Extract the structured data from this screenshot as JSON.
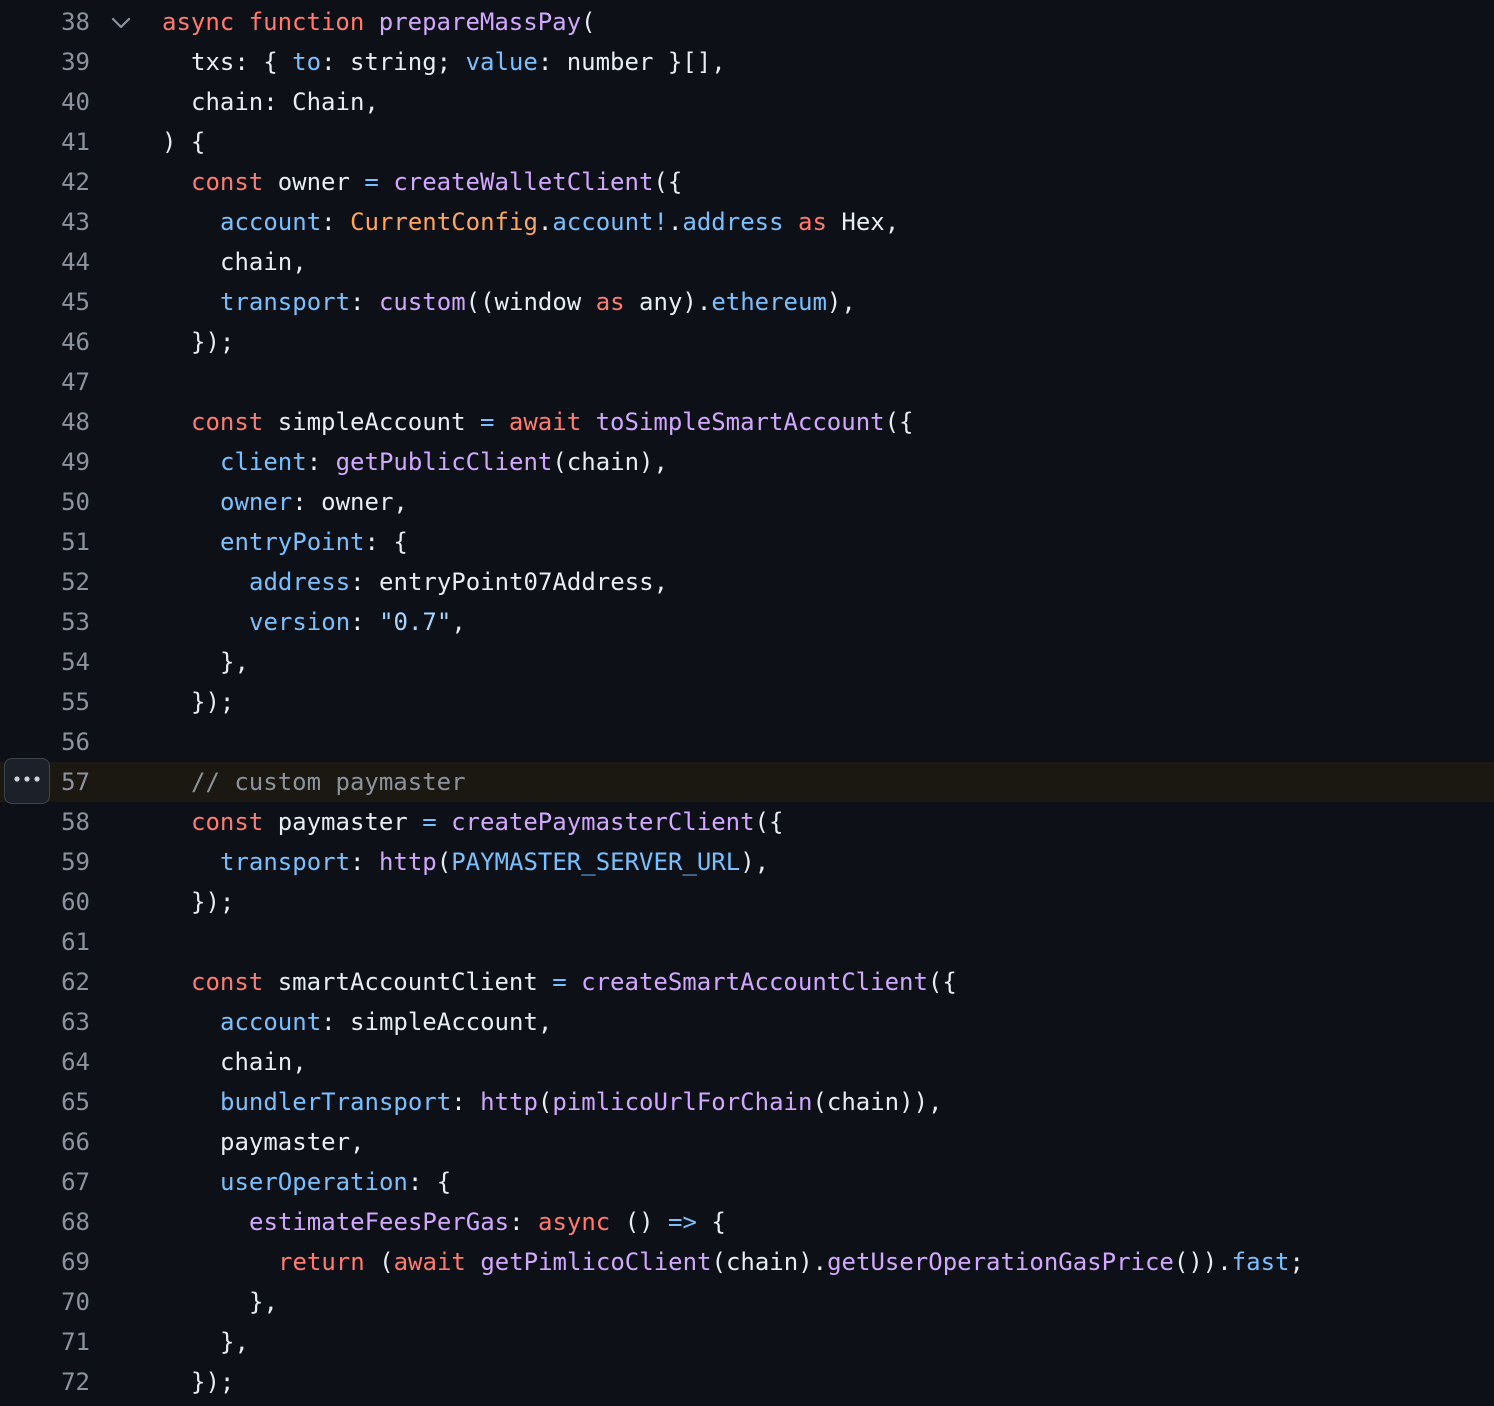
{
  "colors": {
    "background": "#0d1117",
    "line_number": "#8b949e",
    "highlight_background": "#1b1811",
    "text": "#e6edf3",
    "keyword": "#ff7b72",
    "function": "#d2a8ff",
    "property": "#79c0ff",
    "constant": "#ffa657",
    "string": "#a5d6ff",
    "comment": "#8b949e",
    "operator": "#79c0ff"
  },
  "fold_icon": "chevron-down-icon",
  "more_options_icon": "kebab-horizontal-icon",
  "highlighted_line": "57",
  "lines": [
    {
      "number": "38",
      "indent": 0,
      "foldable": true,
      "tokens": [
        {
          "t": "async",
          "c": "keyword"
        },
        {
          "t": " "
        },
        {
          "t": "function",
          "c": "keyword"
        },
        {
          "t": " "
        },
        {
          "t": "prepareMassPay",
          "c": "function"
        },
        {
          "t": "("
        }
      ]
    },
    {
      "number": "39",
      "indent": 1,
      "tokens": [
        {
          "t": "txs: { "
        },
        {
          "t": "to",
          "c": "property"
        },
        {
          "t": ": string; "
        },
        {
          "t": "value",
          "c": "property"
        },
        {
          "t": ": number }[],"
        }
      ]
    },
    {
      "number": "40",
      "indent": 1,
      "tokens": [
        {
          "t": "chain: Chain,"
        }
      ]
    },
    {
      "number": "41",
      "indent": 0,
      "tokens": [
        {
          "t": ") {"
        }
      ]
    },
    {
      "number": "42",
      "indent": 1,
      "tokens": [
        {
          "t": "const",
          "c": "keyword"
        },
        {
          "t": " owner "
        },
        {
          "t": "=",
          "c": "operator"
        },
        {
          "t": " "
        },
        {
          "t": "createWalletClient",
          "c": "function"
        },
        {
          "t": "({"
        }
      ]
    },
    {
      "number": "43",
      "indent": 2,
      "tokens": [
        {
          "t": "account",
          "c": "property"
        },
        {
          "t": ": "
        },
        {
          "t": "CurrentConfig",
          "c": "constant"
        },
        {
          "t": "."
        },
        {
          "t": "account!",
          "c": "property"
        },
        {
          "t": "."
        },
        {
          "t": "address",
          "c": "property"
        },
        {
          "t": " "
        },
        {
          "t": "as",
          "c": "keyword"
        },
        {
          "t": " Hex,"
        }
      ]
    },
    {
      "number": "44",
      "indent": 2,
      "tokens": [
        {
          "t": "chain,"
        }
      ]
    },
    {
      "number": "45",
      "indent": 2,
      "tokens": [
        {
          "t": "transport",
          "c": "property"
        },
        {
          "t": ": "
        },
        {
          "t": "custom",
          "c": "function"
        },
        {
          "t": "((window "
        },
        {
          "t": "as",
          "c": "keyword"
        },
        {
          "t": " any)."
        },
        {
          "t": "ethereum",
          "c": "property"
        },
        {
          "t": "),"
        }
      ]
    },
    {
      "number": "46",
      "indent": 1,
      "tokens": [
        {
          "t": "});"
        }
      ]
    },
    {
      "number": "47",
      "indent": 0,
      "tokens": []
    },
    {
      "number": "48",
      "indent": 1,
      "tokens": [
        {
          "t": "const",
          "c": "keyword"
        },
        {
          "t": " simpleAccount "
        },
        {
          "t": "=",
          "c": "operator"
        },
        {
          "t": " "
        },
        {
          "t": "await",
          "c": "keyword"
        },
        {
          "t": " "
        },
        {
          "t": "toSimpleSmartAccount",
          "c": "function"
        },
        {
          "t": "({"
        }
      ]
    },
    {
      "number": "49",
      "indent": 2,
      "tokens": [
        {
          "t": "client",
          "c": "property"
        },
        {
          "t": ": "
        },
        {
          "t": "getPublicClient",
          "c": "function"
        },
        {
          "t": "(chain),"
        }
      ]
    },
    {
      "number": "50",
      "indent": 2,
      "tokens": [
        {
          "t": "owner",
          "c": "property"
        },
        {
          "t": ": owner,"
        }
      ]
    },
    {
      "number": "51",
      "indent": 2,
      "tokens": [
        {
          "t": "entryPoint",
          "c": "property"
        },
        {
          "t": ": {"
        }
      ]
    },
    {
      "number": "52",
      "indent": 3,
      "tokens": [
        {
          "t": "address",
          "c": "property"
        },
        {
          "t": ": entryPoint07Address,"
        }
      ]
    },
    {
      "number": "53",
      "indent": 3,
      "tokens": [
        {
          "t": "version",
          "c": "property"
        },
        {
          "t": ": "
        },
        {
          "t": "\"0.7\"",
          "c": "string"
        },
        {
          "t": ","
        }
      ]
    },
    {
      "number": "54",
      "indent": 2,
      "tokens": [
        {
          "t": "},"
        }
      ]
    },
    {
      "number": "55",
      "indent": 1,
      "tokens": [
        {
          "t": "});"
        }
      ]
    },
    {
      "number": "56",
      "indent": 0,
      "tokens": []
    },
    {
      "number": "57",
      "indent": 1,
      "tokens": [
        {
          "t": "// custom paymaster",
          "c": "comment"
        }
      ]
    },
    {
      "number": "58",
      "indent": 1,
      "tokens": [
        {
          "t": "const",
          "c": "keyword"
        },
        {
          "t": " paymaster "
        },
        {
          "t": "=",
          "c": "operator"
        },
        {
          "t": " "
        },
        {
          "t": "createPaymasterClient",
          "c": "function"
        },
        {
          "t": "({"
        }
      ]
    },
    {
      "number": "59",
      "indent": 2,
      "tokens": [
        {
          "t": "transport",
          "c": "property"
        },
        {
          "t": ": "
        },
        {
          "t": "http",
          "c": "function"
        },
        {
          "t": "("
        },
        {
          "t": "PAYMASTER_SERVER_URL",
          "c": "property"
        },
        {
          "t": "),"
        }
      ]
    },
    {
      "number": "60",
      "indent": 1,
      "tokens": [
        {
          "t": "});"
        }
      ]
    },
    {
      "number": "61",
      "indent": 0,
      "tokens": []
    },
    {
      "number": "62",
      "indent": 1,
      "tokens": [
        {
          "t": "const",
          "c": "keyword"
        },
        {
          "t": " smartAccountClient "
        },
        {
          "t": "=",
          "c": "operator"
        },
        {
          "t": " "
        },
        {
          "t": "createSmartAccountClient",
          "c": "function"
        },
        {
          "t": "({"
        }
      ]
    },
    {
      "number": "63",
      "indent": 2,
      "tokens": [
        {
          "t": "account",
          "c": "property"
        },
        {
          "t": ": simpleAccount,"
        }
      ]
    },
    {
      "number": "64",
      "indent": 2,
      "tokens": [
        {
          "t": "chain,"
        }
      ]
    },
    {
      "number": "65",
      "indent": 2,
      "tokens": [
        {
          "t": "bundlerTransport",
          "c": "property"
        },
        {
          "t": ": "
        },
        {
          "t": "http",
          "c": "function"
        },
        {
          "t": "("
        },
        {
          "t": "pimlicoUrlForChain",
          "c": "function"
        },
        {
          "t": "(chain)),"
        }
      ]
    },
    {
      "number": "66",
      "indent": 2,
      "tokens": [
        {
          "t": "paymaster,"
        }
      ]
    },
    {
      "number": "67",
      "indent": 2,
      "tokens": [
        {
          "t": "userOperation",
          "c": "property"
        },
        {
          "t": ": {"
        }
      ]
    },
    {
      "number": "68",
      "indent": 3,
      "tokens": [
        {
          "t": "estimateFeesPerGas",
          "c": "function"
        },
        {
          "t": ": "
        },
        {
          "t": "async",
          "c": "keyword"
        },
        {
          "t": " () "
        },
        {
          "t": "=>",
          "c": "operator"
        },
        {
          "t": " {"
        }
      ]
    },
    {
      "number": "69",
      "indent": 4,
      "tokens": [
        {
          "t": "return",
          "c": "keyword"
        },
        {
          "t": " ("
        },
        {
          "t": "await",
          "c": "keyword"
        },
        {
          "t": " "
        },
        {
          "t": "getPimlicoClient",
          "c": "function"
        },
        {
          "t": "(chain)."
        },
        {
          "t": "getUserOperationGasPrice",
          "c": "function"
        },
        {
          "t": "())."
        },
        {
          "t": "fast",
          "c": "property"
        },
        {
          "t": ";"
        }
      ]
    },
    {
      "number": "70",
      "indent": 3,
      "tokens": [
        {
          "t": "},"
        }
      ]
    },
    {
      "number": "71",
      "indent": 2,
      "tokens": [
        {
          "t": "},"
        }
      ]
    },
    {
      "number": "72",
      "indent": 1,
      "tokens": [
        {
          "t": "});"
        }
      ]
    }
  ]
}
